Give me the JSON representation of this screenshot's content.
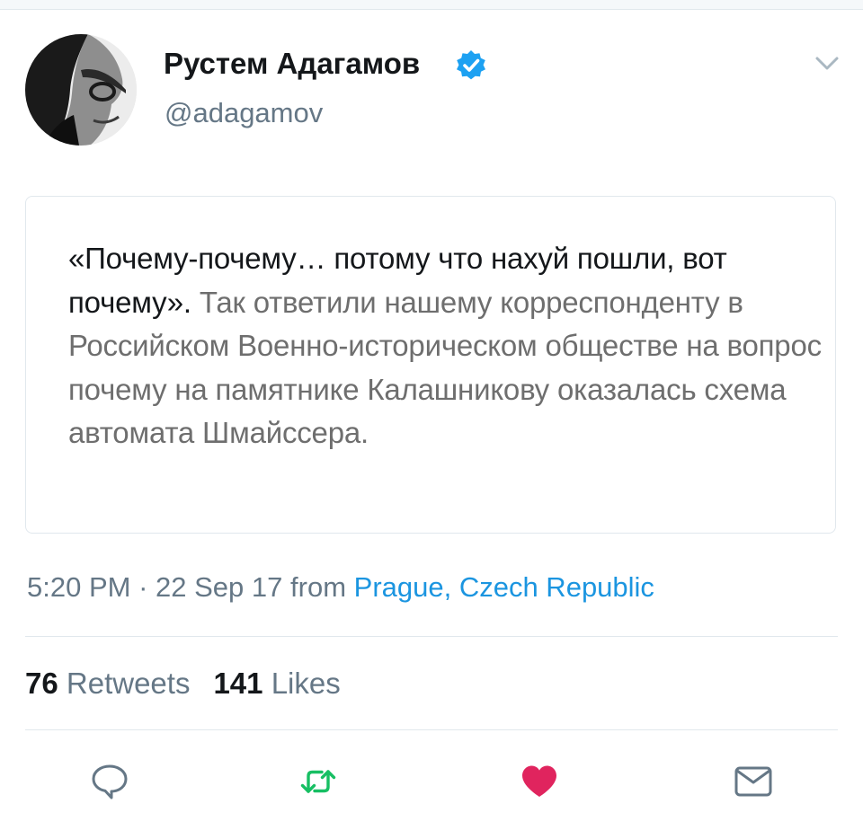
{
  "tweet": {
    "author": {
      "display_name": "Рустем Адагамов",
      "handle": "@adagamov",
      "verified": true
    },
    "quote_image_text": {
      "strong": "«Почему-почему… потому что нахуй пошли, вот почему».",
      "rest": "Так ответили нашему корреспонденту в Российском Военно-историческом обществе на вопрос почему на памятнике Калашникову оказалась схема автомата Шмайссера."
    },
    "meta": {
      "time": "5:20 PM",
      "separator": "·",
      "date": "22 Sep 17",
      "from_label": "from",
      "location": "Prague, Czech Republic"
    },
    "stats": {
      "retweets_count": "76",
      "retweets_label": "Retweets",
      "likes_count": "141",
      "likes_label": "Likes"
    },
    "actions": [
      {
        "name": "reply",
        "icon": "reply-icon"
      },
      {
        "name": "retweet",
        "icon": "retweet-icon"
      },
      {
        "name": "like",
        "icon": "heart-icon",
        "active": true
      },
      {
        "name": "direct-message",
        "icon": "envelope-icon"
      }
    ]
  },
  "colors": {
    "verified_blue": "#1da1f2",
    "link_blue": "#1b95e0",
    "retweet_green": "#17bf63",
    "like_red": "#e0245e",
    "muted_grey": "#657786"
  }
}
